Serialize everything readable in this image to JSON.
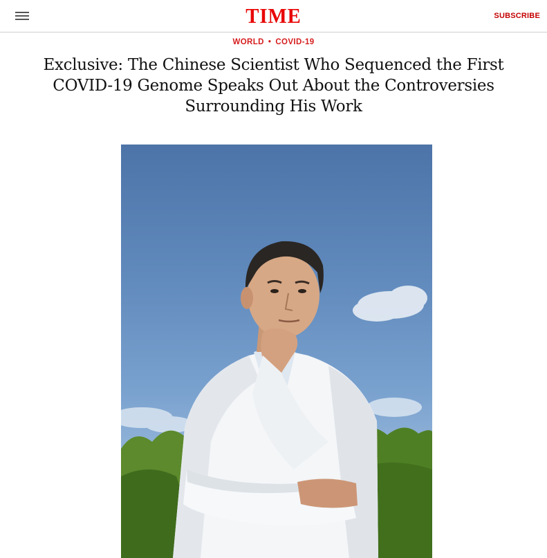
{
  "header": {
    "logo": "TIME",
    "subscribe_label": "SUBSCRIBE",
    "menu_icon": "hamburger-menu-icon",
    "brand_color": "#e90606"
  },
  "kicker": {
    "section": "WORLD",
    "separator": "•",
    "topic": "COVID-19",
    "color": "#d61d1d"
  },
  "article": {
    "headline": "Exclusive: The Chinese Scientist Who Sequenced the First COVID-19 Genome Speaks Out About the Controversies Surrounding His Work"
  }
}
